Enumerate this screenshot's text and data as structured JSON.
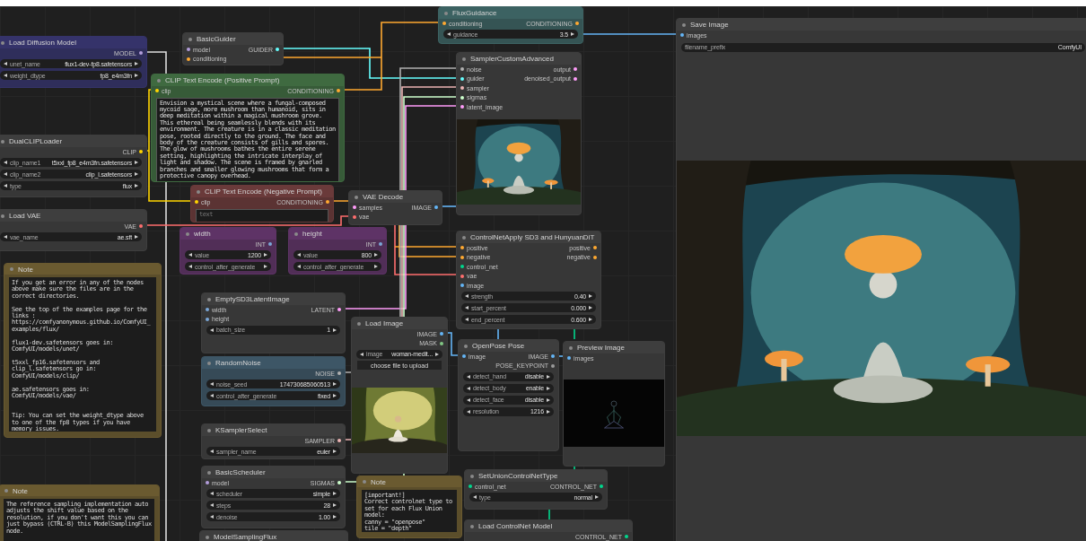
{
  "nodes": [
    {
      "title": "Load Diffusion Model",
      "kind": "node",
      "color": "#35336a",
      "outputs": [
        {
          "label": "MODEL",
          "color": "#b39ddb"
        }
      ],
      "widgets": [
        {
          "kind": "combo",
          "name": "unet_name",
          "value": "flux1-dev-fp8.safetensors"
        },
        {
          "kind": "combo",
          "name": "weight_dtype",
          "value": "fp8_e4m3fn"
        }
      ]
    },
    {
      "title": "DualCLIPLoader",
      "kind": "node",
      "color": "#3e3e3e",
      "outputs": [
        {
          "label": "CLIP",
          "color": "#ffd500"
        }
      ],
      "widgets": [
        {
          "kind": "combo",
          "name": "clip_name1",
          "value": "t5xxl_fp8_e4m3fn.safetensors"
        },
        {
          "kind": "combo",
          "name": "clip_name2",
          "value": "clip_l.safetensors"
        },
        {
          "kind": "combo",
          "name": "type",
          "value": "flux"
        }
      ]
    },
    {
      "title": "Load VAE",
      "kind": "node",
      "color": "#3e3e3e",
      "outputs": [
        {
          "label": "VAE",
          "color": "#ff6e6e"
        }
      ],
      "widgets": [
        {
          "kind": "combo",
          "name": "vae_name",
          "value": "ae.sft"
        }
      ]
    },
    {
      "title": "Note",
      "kind": "note",
      "color": "#6a5a30",
      "text": "If you get an error in any of the nodes above make sure the files are in the correct directories.\n\nSee the top of the examples page for the links : https://comfyanonymous.github.io/ComfyUI_examples/flux/\n\nflux1-dev.safetensors goes in: ComfyUI/models/unet/\n\nt5xxl_fp16.safetensors and clip_l.safetensors go in: ComfyUI/models/clip/\n\nae.safetensors goes in: ComfyUI/models/vae/\n\n\nTip: You can set the weight_dtype above to one of the fp8 types if you have memory issues."
    },
    {
      "title": "Note",
      "kind": "note",
      "color": "#6a5a30",
      "text": "The reference sampling implementation auto adjusts the shift value based on the resolution, if you don't want this you can just bypass (CTRL-B) this ModelSamplingFlux node."
    },
    {
      "title": "BasicGuider",
      "kind": "node",
      "color": "#3e3e3e",
      "inputs": [
        {
          "label": "model",
          "color": "#b39ddb"
        },
        {
          "label": "conditioning",
          "color": "#ffa931"
        }
      ],
      "outputs": [
        {
          "label": "GUIDER",
          "color": "#66ffff"
        }
      ]
    },
    {
      "title": "CLIP Text Encode (Positive Prompt)",
      "kind": "node",
      "color": "#3f6a40",
      "inputs": [
        {
          "label": "clip",
          "color": "#ffd500"
        }
      ],
      "outputs": [
        {
          "label": "CONDITIONING",
          "color": "#ffa931"
        }
      ],
      "text": "Envision a mystical scene where a fungal-composed mycoid sage, more mushroom than humanoid, sits in deep meditation within a magical mushroom grove. This ethereal being seamlessly blends with its environment. The creature is in a classic meditation pose, rooted directly to the ground. The face and body of the creature consists of gills and spores. The glow of mushrooms bathes the entire serene setting, highlighting the intricate interplay of light and shadow. The scene is framed by gnarled branches and smaller glowing mushrooms that form a protective canopy overhead."
    },
    {
      "title": "CLIP Text Encode (Negative Prompt)",
      "kind": "node",
      "color": "#6a3a3a",
      "inputs": [
        {
          "label": "clip",
          "color": "#ffd500"
        }
      ],
      "outputs": [
        {
          "label": "CONDITIONING",
          "color": "#ffa931"
        }
      ],
      "placeholder": "text"
    },
    {
      "title": "width",
      "kind": "node",
      "color": "#5e3366",
      "outputs": [
        {
          "label": "INT",
          "color": "#7aa6d6"
        }
      ],
      "widgets": [
        {
          "kind": "combo",
          "name": "value",
          "value": "1200"
        },
        {
          "kind": "combo",
          "name": "control_after_generate"
        }
      ]
    },
    {
      "title": "height",
      "kind": "node",
      "color": "#5e3366",
      "outputs": [
        {
          "label": "INT",
          "color": "#7aa6d6"
        }
      ],
      "widgets": [
        {
          "kind": "combo",
          "name": "value",
          "value": "800"
        },
        {
          "kind": "combo",
          "name": "control_after_generate"
        }
      ]
    },
    {
      "title": "EmptySD3LatentImage",
      "kind": "node",
      "color": "#3e3e3e",
      "inputs": [
        {
          "label": "width",
          "color": "#7aa6d6"
        },
        {
          "label": "height",
          "color": "#7aa6d6"
        }
      ],
      "outputs": [
        {
          "label": "LATENT",
          "color": "#ff9cf9"
        }
      ],
      "widgets": [
        {
          "kind": "combo",
          "name": "batch_size",
          "value": "1"
        }
      ]
    },
    {
      "title": "RandomNoise",
      "kind": "node",
      "color": "#3d5666",
      "outputs": [
        {
          "label": "NOISE",
          "color": "#b0b0b0"
        }
      ],
      "widgets": [
        {
          "kind": "combo",
          "name": "noise_seed",
          "value": "174730685060513"
        },
        {
          "kind": "combo",
          "name": "control_after_generate",
          "value": "fixed"
        }
      ]
    },
    {
      "title": "KSamplerSelect",
      "kind": "node",
      "color": "#3e3e3e",
      "outputs": [
        {
          "label": "SAMPLER",
          "color": "#ecb4b4"
        }
      ],
      "widgets": [
        {
          "kind": "combo",
          "name": "sampler_name",
          "value": "euler"
        }
      ]
    },
    {
      "title": "BasicScheduler",
      "kind": "node",
      "color": "#3e3e3e",
      "inputs": [
        {
          "label": "model",
          "color": "#b39ddb"
        }
      ],
      "outputs": [
        {
          "label": "SIGMAS",
          "color": "#cdffcd"
        }
      ],
      "widgets": [
        {
          "kind": "combo",
          "name": "scheduler",
          "value": "simple"
        },
        {
          "kind": "combo",
          "name": "steps",
          "value": "28"
        },
        {
          "kind": "combo",
          "name": "denoise",
          "value": "1.00"
        }
      ]
    },
    {
      "title": "ModelSamplingFlux",
      "kind": "node",
      "color": "#3e3e3e"
    },
    {
      "title": "FluxGuidance",
      "kind": "node",
      "color": "#3c6262",
      "inputs": [
        {
          "label": "conditioning",
          "color": "#ffa931"
        }
      ],
      "outputs": [
        {
          "label": "CONDITIONING",
          "color": "#ffa931"
        }
      ],
      "widgets": [
        {
          "kind": "combo",
          "name": "guidance",
          "value": "3.5"
        }
      ]
    },
    {
      "title": "SamplerCustomAdvanced",
      "kind": "node",
      "color": "#3e3e3e",
      "inputs": [
        {
          "label": "noise",
          "color": "#b0b0b0"
        },
        {
          "label": "guider",
          "color": "#66ffff"
        },
        {
          "label": "sampler",
          "color": "#ecb4b4"
        },
        {
          "label": "sigmas",
          "color": "#cdffcd"
        },
        {
          "label": "latent_image",
          "color": "#ff9cf9"
        }
      ],
      "outputs": [
        {
          "label": "output",
          "color": "#ff9cf9"
        },
        {
          "label": "denoised_output",
          "color": "#ff9cf9"
        }
      ],
      "image": {
        "kind": "picture"
      }
    },
    {
      "title": "VAE Decode",
      "kind": "node",
      "color": "#3e3e3e",
      "inputs": [
        {
          "label": "samples",
          "color": "#ff9cf9"
        },
        {
          "label": "vae",
          "color": "#ff6e6e"
        }
      ],
      "outputs": [
        {
          "label": "IMAGE",
          "color": "#64b5f6"
        }
      ]
    },
    {
      "title": "ControlNetApply SD3 and HunyuanDiT",
      "kind": "node",
      "color": "#3e3e3e",
      "inputs": [
        {
          "label": "positive",
          "color": "#ffa931"
        },
        {
          "label": "negative",
          "color": "#ffa931"
        },
        {
          "label": "control_net",
          "color": "#00d78d"
        },
        {
          "label": "vae",
          "color": "#ff6e6e"
        },
        {
          "label": "image",
          "color": "#64b5f6"
        }
      ],
      "outputs": [
        {
          "label": "positive",
          "color": "#ffa931"
        },
        {
          "label": "negative",
          "color": "#ffa931"
        }
      ],
      "widgets": [
        {
          "kind": "combo",
          "name": "strength",
          "value": "0.40"
        },
        {
          "kind": "combo",
          "name": "start_percent",
          "value": "0.000"
        },
        {
          "kind": "combo",
          "name": "end_percent",
          "value": "0.600"
        }
      ]
    },
    {
      "title": "Load Image",
      "kind": "node",
      "color": "#3e3e3e",
      "outputs": [
        {
          "label": "IMAGE",
          "color": "#64b5f6"
        },
        {
          "label": "MASK",
          "color": "#81c784"
        }
      ],
      "widgets": [
        {
          "kind": "combo",
          "name": "image",
          "value": "woman-medit..."
        }
      ],
      "button": "choose file to upload",
      "image": {
        "kind": "picture"
      }
    },
    {
      "title": "OpenPose Pose",
      "kind": "node",
      "color": "#3e3e3e",
      "inputs": [
        {
          "label": "image",
          "color": "#64b5f6"
        }
      ],
      "outputs": [
        {
          "label": "IMAGE",
          "color": "#64b5f6"
        },
        {
          "label": "POSE_KEYPOINT",
          "color": "#9a9a9a"
        }
      ],
      "widgets": [
        {
          "kind": "combo",
          "name": "detect_hand",
          "value": "disable"
        },
        {
          "kind": "combo",
          "name": "detect_body",
          "value": "enable"
        },
        {
          "kind": "combo",
          "name": "detect_face",
          "value": "disable"
        },
        {
          "kind": "combo",
          "name": "resolution",
          "value": "1216"
        }
      ]
    },
    {
      "title": "Preview Image",
      "kind": "node",
      "color": "#3e3e3e",
      "inputs": [
        {
          "label": "images",
          "color": "#64b5f6"
        }
      ],
      "image": {
        "kind": "picture"
      }
    },
    {
      "title": "SetUnionControlNetType",
      "kind": "node",
      "color": "#3e3e3e",
      "inputs": [
        {
          "label": "control_net",
          "color": "#00d78d"
        }
      ],
      "outputs": [
        {
          "label": "CONTROL_NET",
          "color": "#00d78d"
        }
      ],
      "widgets": [
        {
          "kind": "combo",
          "name": "type",
          "value": "normal"
        }
      ]
    },
    {
      "title": "Load ControlNet Model",
      "kind": "node",
      "color": "#3e3e3e",
      "outputs": [
        {
          "label": "CONTROL_NET",
          "color": "#00d78d"
        }
      ]
    },
    {
      "title": "Note",
      "kind": "note",
      "color": "#6a5a30",
      "text": "[important!]\nCorrect controlnet type to set for each Flux Union model:\ncanny = \"openpose\"\ntile = \"depth\""
    },
    {
      "title": "Save Image",
      "kind": "node",
      "color": "#3e3e3e",
      "inputs": [
        {
          "label": "images",
          "color": "#64b5f6"
        }
      ],
      "widgets": [
        {
          "kind": "text",
          "name": "filename_prefix",
          "value": "ComfyUI"
        }
      ],
      "image": {
        "kind": "picture"
      }
    }
  ]
}
